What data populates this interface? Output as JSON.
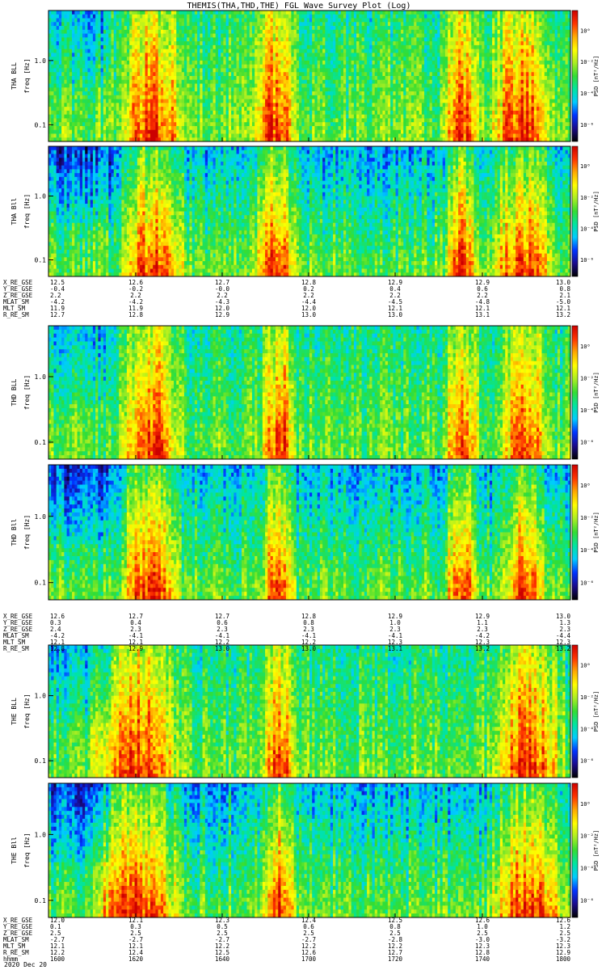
{
  "title": "THEMIS(THA,THD,THE) FGL Wave Survey Plot (Log)",
  "footer": {
    "hhmm_label": "hhmm",
    "date": "2020 Dec 20"
  },
  "colors": {
    "colormap": [
      "#000000",
      "#1a0a8c",
      "#0033ff",
      "#00ccff",
      "#00e5a0",
      "#33dd33",
      "#aaee22",
      "#ffff00",
      "#ffaa00",
      "#ff3300",
      "#cc0000"
    ]
  },
  "probes": [
    {
      "panels": [
        {
          "ylabel_top": "THA BLL",
          "ylabel_bottom": "freq [Hz]",
          "yticks": [
            "1.0",
            "0.1"
          ],
          "cbar_label": "PSD [nT²/Hz]",
          "cbar_ticks": [
            "10⁰",
            "10⁻²",
            "10⁻⁴",
            "10⁻⁶"
          ]
        },
        {
          "ylabel_top": "THA Bll",
          "ylabel_bottom": "freq [Hz]",
          "yticks": [
            "1.0",
            "0.1"
          ],
          "cbar_label": "PSD [nT²/Hz]",
          "cbar_ticks": [
            "10⁰",
            "10⁻²",
            "10⁻⁴",
            "10⁻⁶"
          ]
        }
      ],
      "ephem": [
        {
          "label": "X_RE_GSE",
          "values": [
            "12.5",
            "12.6",
            "12.7",
            "12.8",
            "12.9",
            "12.9",
            "13.0"
          ]
        },
        {
          "label": "Y_RE_GSE",
          "values": [
            "-0.4",
            "-0.2",
            "-0.0",
            "0.2",
            "0.4",
            "0.6",
            "0.8"
          ]
        },
        {
          "label": "Z_RE_GSE",
          "values": [
            "2.2",
            "2.2",
            "2.2",
            "2.2",
            "2.2",
            "2.2",
            "2.1"
          ]
        },
        {
          "label": "MLAT_SM",
          "values": [
            "-4.2",
            "-4.2",
            "-4.3",
            "-4.4",
            "-4.5",
            "-4.8",
            "-5.0"
          ]
        },
        {
          "label": "MLT_SM",
          "values": [
            "11.9",
            "11.9",
            "12.0",
            "12.0",
            "12.1",
            "12.1",
            "12.1"
          ]
        },
        {
          "label": "R_RE_SM",
          "values": [
            "12.7",
            "12.8",
            "12.9",
            "13.0",
            "13.0",
            "13.1",
            "13.2"
          ]
        }
      ]
    },
    {
      "panels": [
        {
          "ylabel_top": "THD BLL",
          "ylabel_bottom": "freq [Hz]",
          "yticks": [
            "1.0",
            "0.1"
          ],
          "cbar_label": "PSD [nT²/Hz]",
          "cbar_ticks": [
            "10⁰",
            "10⁻²",
            "10⁻⁴",
            "10⁻⁶"
          ]
        },
        {
          "ylabel_top": "THD Bll",
          "ylabel_bottom": "freq [Hz]",
          "yticks": [
            "1.0",
            "0.1"
          ],
          "cbar_label": "PSD [nT²/Hz]",
          "cbar_ticks": [
            "10⁰",
            "10⁻²",
            "10⁻⁴",
            "10⁻⁶"
          ]
        }
      ],
      "ephem": [
        {
          "label": "X_RE_GSE",
          "values": [
            "12.6",
            "12.7",
            "12.7",
            "12.8",
            "12.9",
            "12.9",
            "13.0"
          ]
        },
        {
          "label": "Y_RE_GSE",
          "values": [
            "0.3",
            "0.4",
            "0.6",
            "0.8",
            "1.0",
            "1.1",
            "1.3"
          ]
        },
        {
          "label": "Z_RE_GSE",
          "values": [
            "2.4",
            "2.3",
            "2.3",
            "2.3",
            "2.3",
            "2.3",
            "2.3"
          ]
        },
        {
          "label": "MLAT_SM",
          "values": [
            "-4.2",
            "-4.1",
            "-4.1",
            "-4.1",
            "-4.1",
            "-4.2",
            "-4.4"
          ]
        },
        {
          "label": "MLT_SM",
          "values": [
            "12.1",
            "12.1",
            "12.2",
            "12.2",
            "12.3",
            "12.3",
            "12.3"
          ]
        },
        {
          "label": "R_RE_SM",
          "values": [
            "12.8",
            "12.9",
            "13.0",
            "13.0",
            "13.1",
            "13.2",
            "13.2"
          ]
        }
      ]
    },
    {
      "panels": [
        {
          "ylabel_top": "THE BLL",
          "ylabel_bottom": "freq [Hz]",
          "yticks": [
            "1.0",
            "0.1"
          ],
          "cbar_label": "PSD [nT²/Hz]",
          "cbar_ticks": [
            "10⁰",
            "10⁻²",
            "10⁻⁴",
            "10⁻⁶"
          ]
        },
        {
          "ylabel_top": "THE Bll",
          "ylabel_bottom": "freq [Hz]",
          "yticks": [
            "1.0",
            "0.1"
          ],
          "cbar_label": "PSD [nT²/Hz]",
          "cbar_ticks": [
            "10⁰",
            "10⁻²",
            "10⁻⁴",
            "10⁻⁶"
          ]
        }
      ],
      "ephem": [
        {
          "label": "X_RE_GSE",
          "values": [
            "12.0",
            "12.1",
            "12.3",
            "12.4",
            "12.5",
            "12.6",
            "12.6"
          ]
        },
        {
          "label": "Y_RE_GSE",
          "values": [
            "0.1",
            "0.3",
            "0.5",
            "0.6",
            "0.8",
            "1.0",
            "1.2"
          ]
        },
        {
          "label": "Z_RE_GSE",
          "values": [
            "2.5",
            "2.5",
            "2.5",
            "2.5",
            "2.5",
            "2.5",
            "2.5"
          ]
        },
        {
          "label": "MLAT_SM",
          "values": [
            "-2.7",
            "-2.7",
            "-2.7",
            "-2.7",
            "-2.8",
            "-3.0",
            "-3.2"
          ]
        },
        {
          "label": "MLT_SM",
          "values": [
            "12.1",
            "12.1",
            "12.2",
            "12.2",
            "12.2",
            "12.3",
            "12.3"
          ]
        },
        {
          "label": "R_RE_SM",
          "values": [
            "12.2",
            "12.4",
            "12.5",
            "12.6",
            "12.7",
            "12.8",
            "12.9"
          ]
        }
      ],
      "hhmm": [
        "1600",
        "1620",
        "1640",
        "1700",
        "1720",
        "1740",
        "1800"
      ]
    }
  ],
  "chart_data": {
    "type": "heatmap",
    "title": "THEMIS(THA,THD,THE) FGL Wave Survey Plot (Log)",
    "x_axis": {
      "label": "hhmm",
      "ticks": [
        "1600",
        "1620",
        "1640",
        "1700",
        "1720",
        "1740",
        "1800"
      ],
      "range": [
        "1600",
        "1800"
      ],
      "date": "2020 Dec 20"
    },
    "y_axis": {
      "label": "freq [Hz]",
      "scale": "log",
      "ticks": [
        1.0,
        0.1
      ],
      "range": [
        0.055,
        6.0
      ]
    },
    "colorbar": {
      "label": "PSD [nT²/Hz]",
      "scale": "log",
      "ticks": [
        "10⁰",
        "10⁻²",
        "10⁻⁴",
        "10⁻⁶"
      ],
      "colormap": "rainbow (black-blue-cyan-green-yellow-red)"
    },
    "panels": [
      "THA BLL",
      "THA Bll",
      "THD BLL",
      "THD Bll",
      "THE BLL",
      "THE Bll"
    ],
    "enhanced_activity_hhmm": [
      {
        "probe": "THA",
        "intervals": [
          [
            "1617",
            "1631"
          ],
          [
            "1648",
            "1656"
          ],
          [
            "1732",
            "1738"
          ],
          [
            "1742",
            "1756"
          ]
        ]
      },
      {
        "probe": "THD",
        "intervals": [
          [
            "1617",
            "1630"
          ],
          [
            "1650",
            "1656"
          ],
          [
            "1732",
            "1738"
          ],
          [
            "1745",
            "1754"
          ]
        ]
      },
      {
        "probe": "THE",
        "intervals": [
          [
            "1610",
            "1630"
          ],
          [
            "1650",
            "1656"
          ],
          [
            "1742",
            "1758"
          ]
        ]
      }
    ]
  }
}
